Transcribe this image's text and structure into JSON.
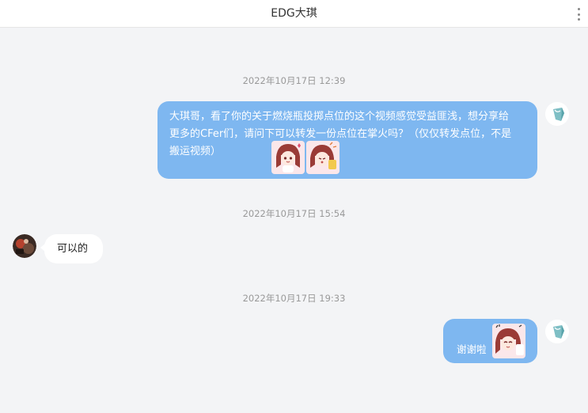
{
  "header": {
    "title": "EDG大琪",
    "menu_icon": "more-vertical-icon"
  },
  "messages": [
    {
      "timestamp": "2022年10月17日 12:39",
      "direction": "outgoing",
      "text": "大琪哥，看了你的关于燃烧瓶投掷点位的这个视频感觉受益匪浅，想分享给更多的CFer们，请问下可以转发一份点位在掌火吗？（仅仅转发点位，不是搬运视频）",
      "stickers": [
        "anime-girl-sticker",
        "anime-girl-sticker"
      ]
    },
    {
      "timestamp": "2022年10月17日 15:54",
      "direction": "incoming",
      "text": "可以的"
    },
    {
      "timestamp": "2022年10月17日 19:33",
      "direction": "outgoing",
      "text": "谢谢啦",
      "stickers": [
        "anime-girl-sticker"
      ]
    }
  ],
  "colors": {
    "outgoing_bubble": "#7eb7f0",
    "incoming_bubble": "#ffffff",
    "background": "#f3f4f6",
    "timestamp": "#999999"
  }
}
